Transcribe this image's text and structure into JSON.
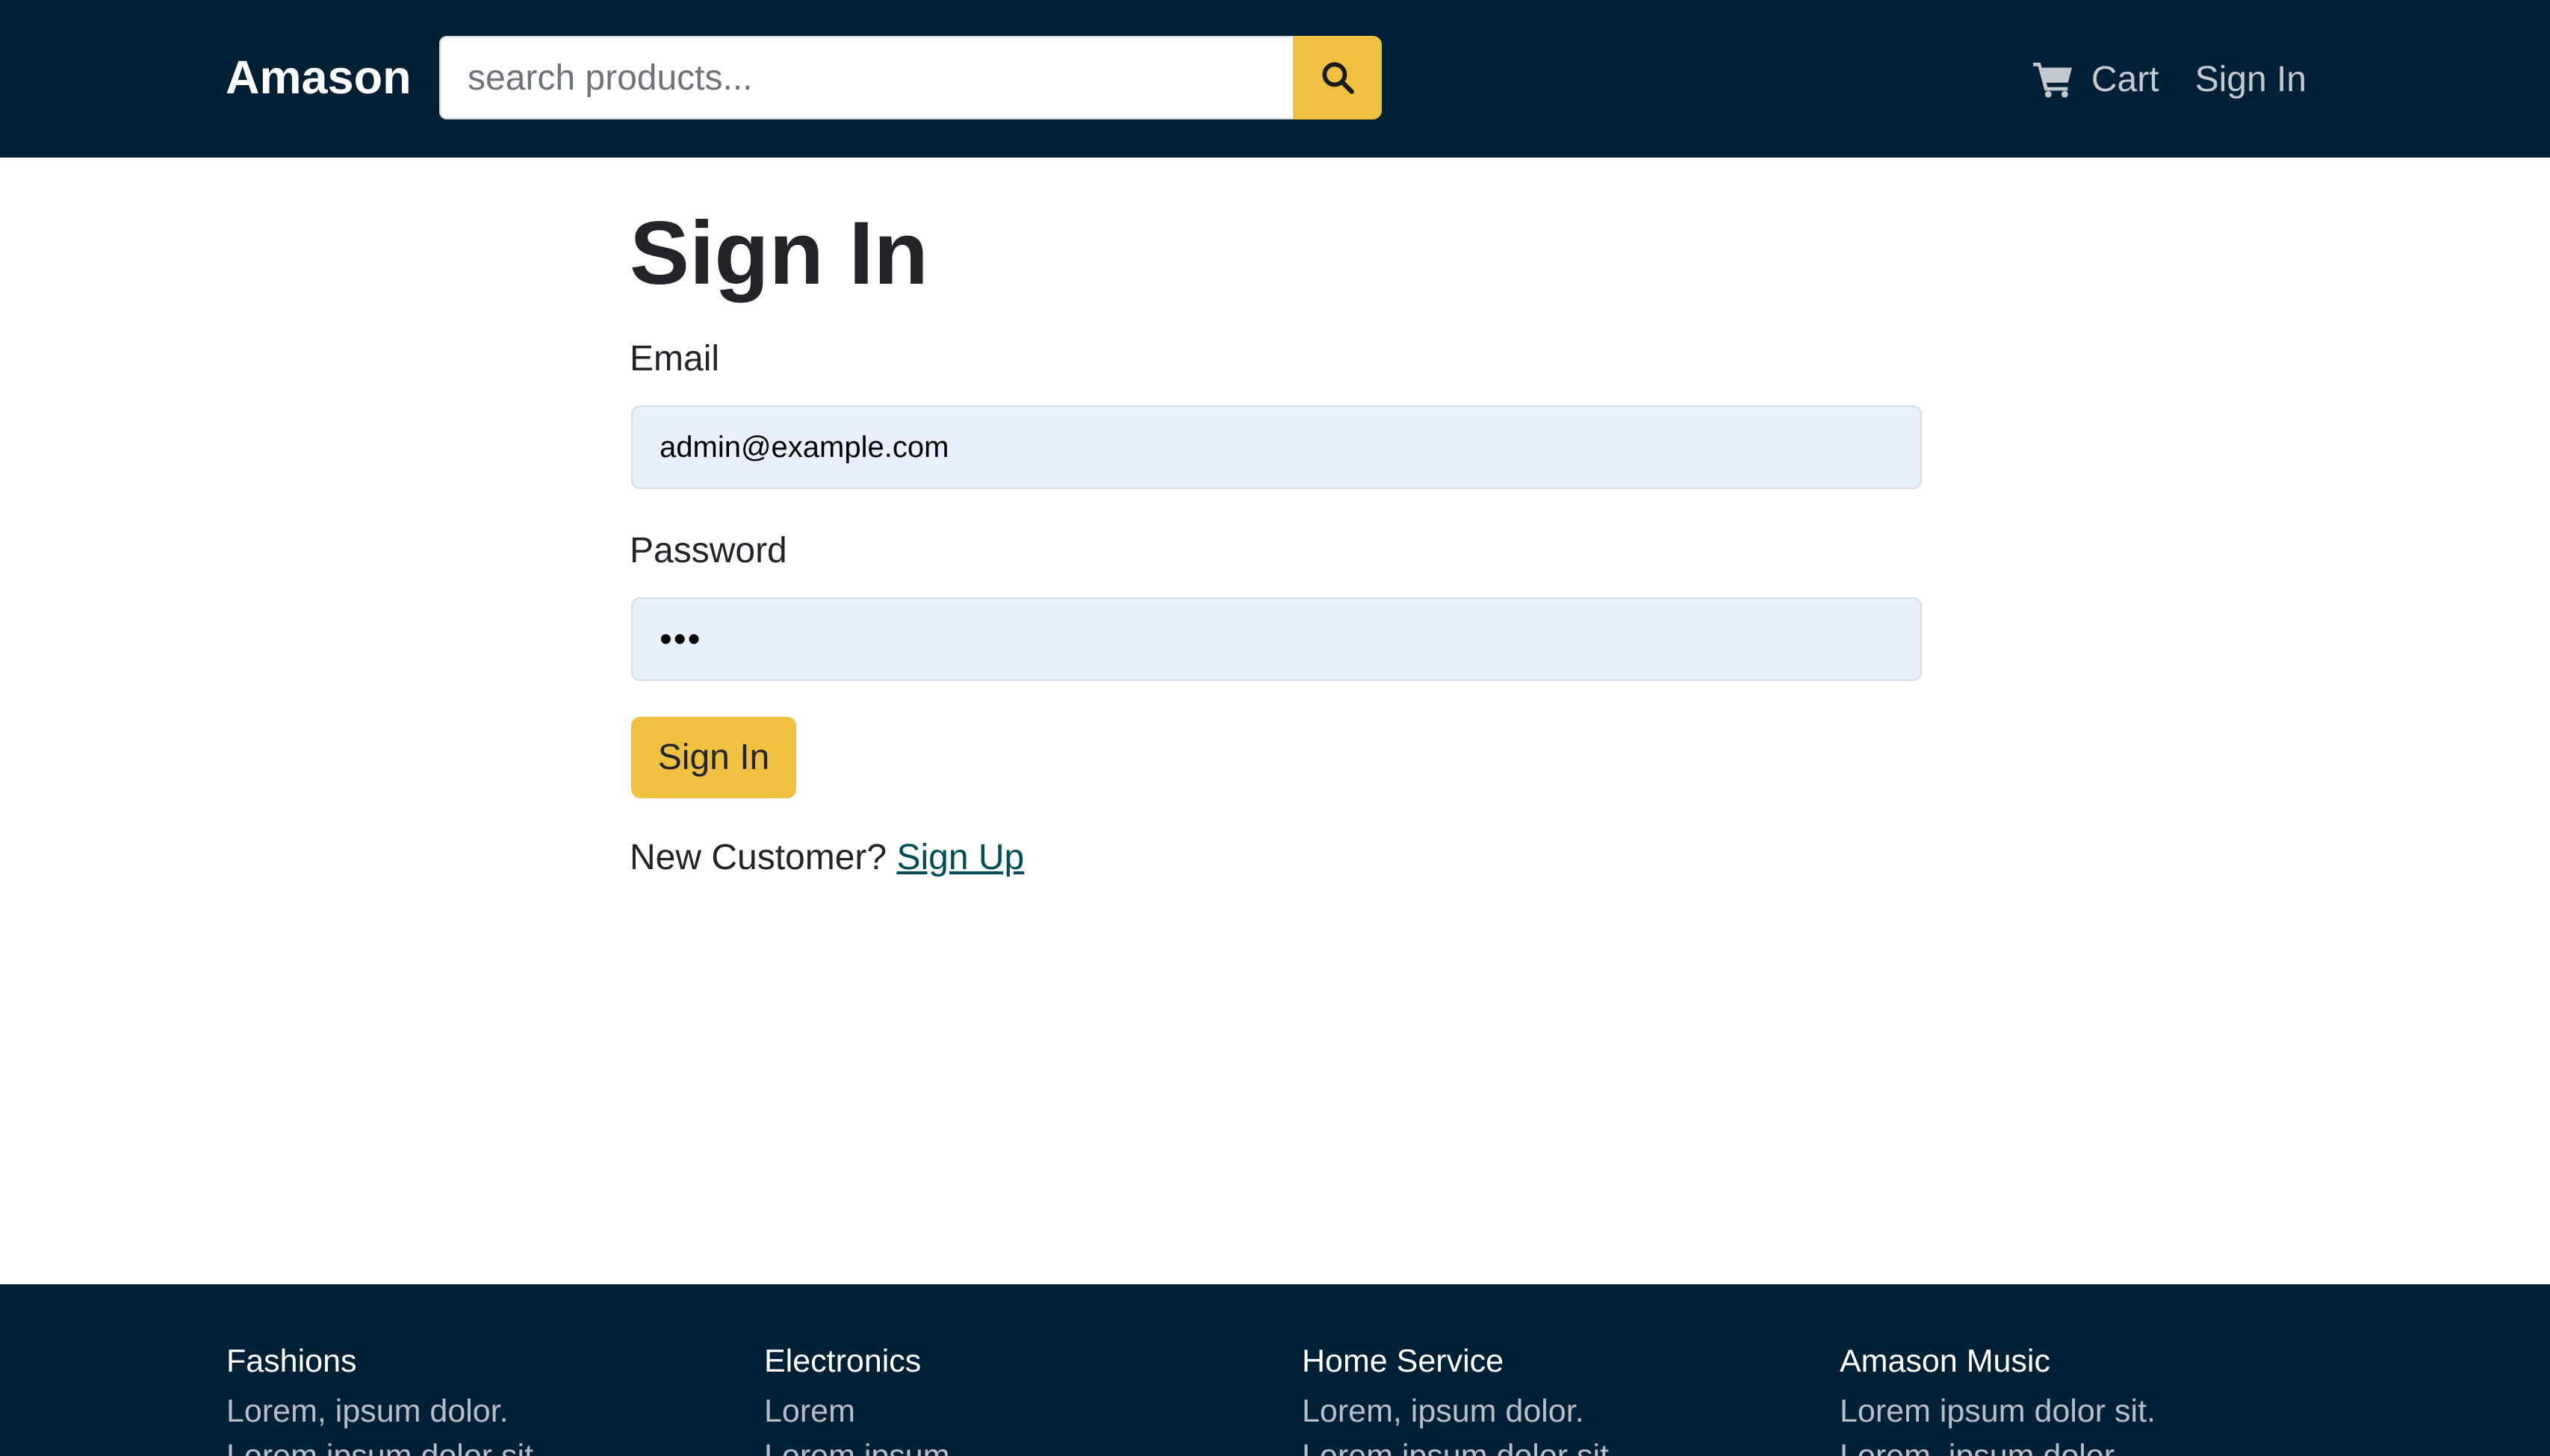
{
  "header": {
    "brand": "Amason",
    "search": {
      "placeholder": "search products...",
      "value": ""
    },
    "nav": {
      "cart_label": "Cart",
      "signin_label": "Sign In"
    }
  },
  "main": {
    "title": "Sign In",
    "email": {
      "label": "Email",
      "value": "admin@example.com"
    },
    "password": {
      "label": "Password",
      "value": "123"
    },
    "submit_label": "Sign In",
    "new_customer_text": "New Customer?",
    "signup_link_label": "Sign Up"
  },
  "footer": {
    "columns": [
      {
        "title": "Fashions",
        "links": [
          "Lorem, ipsum dolor.",
          "Lorem ipsum dolor sit."
        ]
      },
      {
        "title": "Electronics",
        "links": [
          "Lorem",
          "Lorem ipsum"
        ]
      },
      {
        "title": "Home Service",
        "links": [
          "Lorem, ipsum dolor.",
          "Lorem ipsum dolor sit."
        ]
      },
      {
        "title": "Amason Music",
        "links": [
          "Lorem ipsum dolor sit.",
          "Lorem, ipsum dolor."
        ]
      }
    ]
  },
  "colors": {
    "header_bg": "#002035",
    "accent": "#f0c040",
    "input_bg": "#e8f0fe",
    "link": "#004d5a",
    "nav_text": "#c4c9ce",
    "footer_link": "#b8bec5"
  },
  "icons": {
    "search": "magnifier-icon",
    "cart": "shopping-cart-icon"
  }
}
